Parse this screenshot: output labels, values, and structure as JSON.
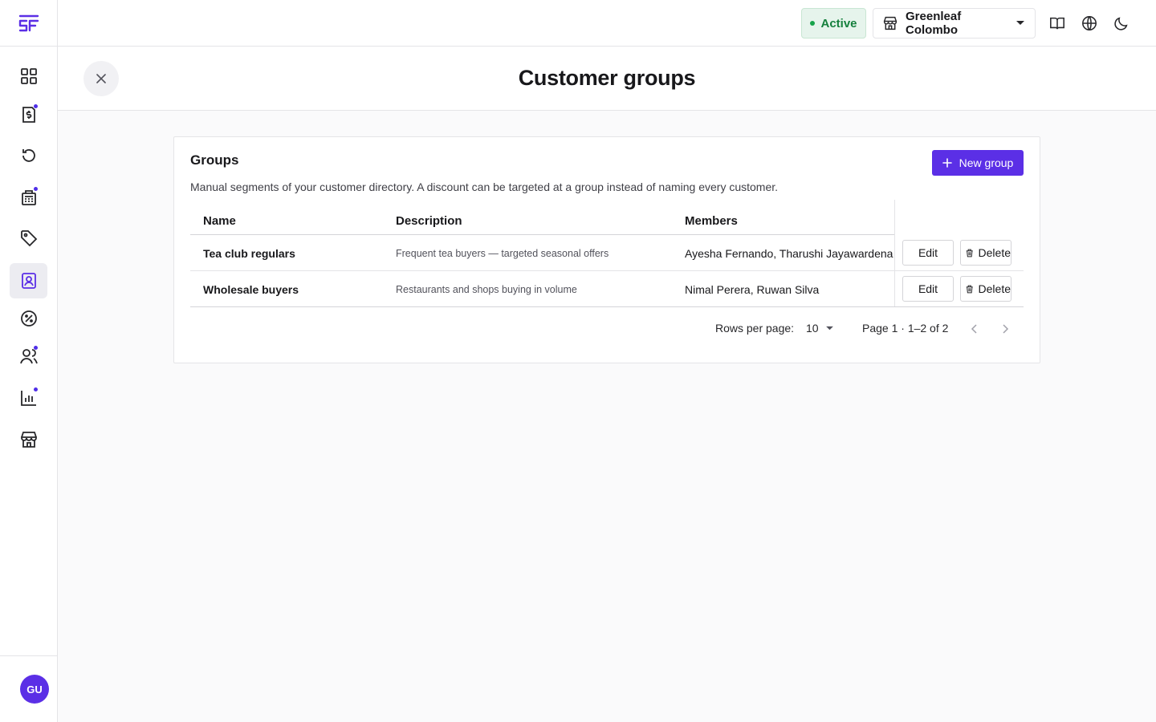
{
  "topbar": {
    "status": "Active",
    "store": "Greenleaf Colombo",
    "icons": [
      "book-icon",
      "globe-icon",
      "moon-icon"
    ]
  },
  "sidebar": {
    "logo": "SF",
    "items": [
      {
        "icon": "dashboard-grid-icon",
        "dot": false
      },
      {
        "icon": "invoice-dollar-icon",
        "dot": true
      },
      {
        "icon": "refund-history-icon",
        "dot": false
      },
      {
        "icon": "register-icon",
        "dot": true
      },
      {
        "icon": "tag-icon",
        "dot": false
      },
      {
        "icon": "customer-contact-icon",
        "dot": false,
        "active": true
      },
      {
        "icon": "discount-percent-icon",
        "dot": false
      },
      {
        "icon": "users-icon",
        "dot": true
      },
      {
        "icon": "bar-chart-icon",
        "dot": true
      },
      {
        "icon": "store-icon",
        "dot": false
      }
    ],
    "avatar": "GU"
  },
  "page": {
    "title": "Customer groups"
  },
  "card": {
    "title": "Groups",
    "description": "Manual segments of your customer directory. A discount can be targeted at a group instead of naming every customer.",
    "new_button": "New group",
    "columns": [
      "Name",
      "Description",
      "Members"
    ],
    "rows": [
      {
        "name": "Tea club regulars",
        "description": "Frequent tea buyers — targeted seasonal offers",
        "members": "Ayesha Fernando, Tharushi Jayawardena"
      },
      {
        "name": "Wholesale buyers",
        "description": "Restaurants and shops buying in volume",
        "members": "Nimal Perera, Ruwan Silva"
      }
    ],
    "edit_label": "Edit",
    "delete_label": "Delete"
  },
  "pagination": {
    "rows_per_page_label": "Rows per page:",
    "rows_per_page": "10",
    "page_info": "Page 1 · 1–2 of 2"
  },
  "colors": {
    "accent": "#5b2fe6",
    "status_green": "#15803d"
  }
}
